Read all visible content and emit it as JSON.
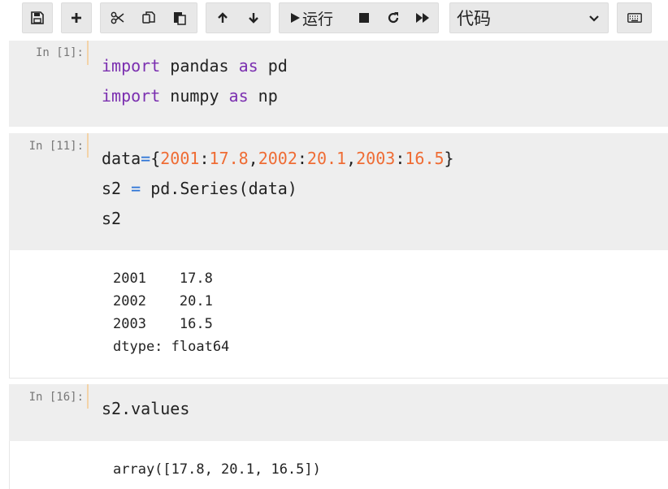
{
  "toolbar": {
    "run_label": "运行",
    "cell_type": "代码"
  },
  "cells": [
    {
      "prompt": "In [1]:",
      "code": [
        [
          {
            "t": "kw",
            "v": "import"
          },
          {
            "t": "p",
            "v": " pandas "
          },
          {
            "t": "kw",
            "v": "as"
          },
          {
            "t": "p",
            "v": " pd"
          }
        ],
        [
          {
            "t": "kw",
            "v": "import"
          },
          {
            "t": "p",
            "v": " numpy "
          },
          {
            "t": "kw",
            "v": "as"
          },
          {
            "t": "p",
            "v": " np"
          }
        ]
      ],
      "output": []
    },
    {
      "prompt": "In [11]:",
      "code": [
        [
          {
            "t": "p",
            "v": "data"
          },
          {
            "t": "op",
            "v": "="
          },
          {
            "t": "p",
            "v": "{"
          },
          {
            "t": "num",
            "v": "2001"
          },
          {
            "t": "p",
            "v": ":"
          },
          {
            "t": "num",
            "v": "17.8"
          },
          {
            "t": "p",
            "v": ","
          },
          {
            "t": "num",
            "v": "2002"
          },
          {
            "t": "p",
            "v": ":"
          },
          {
            "t": "num",
            "v": "20.1"
          },
          {
            "t": "p",
            "v": ","
          },
          {
            "t": "num",
            "v": "2003"
          },
          {
            "t": "p",
            "v": ":"
          },
          {
            "t": "num",
            "v": "16.5"
          },
          {
            "t": "p",
            "v": "}"
          }
        ],
        [
          {
            "t": "p",
            "v": "s2 "
          },
          {
            "t": "op",
            "v": "="
          },
          {
            "t": "p",
            "v": " pd.Series(data)"
          }
        ],
        [
          {
            "t": "p",
            "v": "s2"
          }
        ]
      ],
      "output": [
        "2001    17.8",
        "2002    20.1",
        "2003    16.5",
        "dtype: float64"
      ]
    },
    {
      "prompt": "In [16]:",
      "code": [
        [
          {
            "t": "p",
            "v": "s2.values"
          }
        ]
      ],
      "output": [
        "array([17.8, 20.1, 16.5])"
      ]
    }
  ]
}
